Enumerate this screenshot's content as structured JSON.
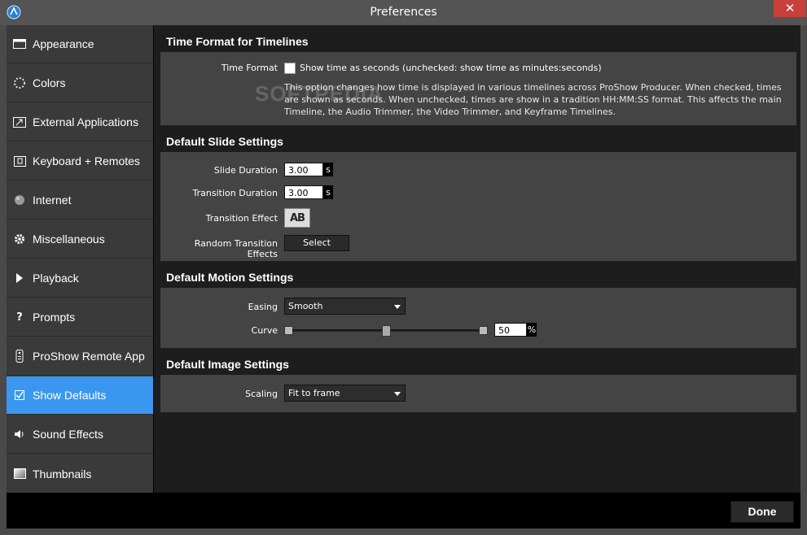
{
  "window": {
    "title": "Preferences",
    "close_glyph": "✕"
  },
  "sidebar": {
    "items": [
      {
        "label": "Appearance",
        "icon": "appearance-icon"
      },
      {
        "label": "Colors",
        "icon": "colors-icon"
      },
      {
        "label": "External Applications",
        "icon": "external-apps-icon"
      },
      {
        "label": "Keyboard + Remotes",
        "icon": "keyboard-icon"
      },
      {
        "label": "Internet",
        "icon": "internet-icon"
      },
      {
        "label": "Miscellaneous",
        "icon": "gear-icon"
      },
      {
        "label": "Playback",
        "icon": "play-icon"
      },
      {
        "label": "Prompts",
        "icon": "question-icon"
      },
      {
        "label": "ProShow Remote App",
        "icon": "remote-icon"
      },
      {
        "label": "Show Defaults",
        "icon": "checkbox-icon",
        "active": true
      },
      {
        "label": "Sound Effects",
        "icon": "speaker-icon"
      },
      {
        "label": "Thumbnails",
        "icon": "thumbnail-icon"
      }
    ]
  },
  "time_format": {
    "section_title": "Time Format for Timelines",
    "label": "Time Format",
    "checkbox_label": "Show time as seconds (unchecked: show time as minutes:seconds)",
    "checked": false,
    "description": "This option changes how time is displayed in various timelines across ProShow Producer. When checked, times are shown as seconds. When unchecked, times are show in a tradition HH:MM:SS format. This affects the main Timeline, the Audio Trimmer, the Video Trimmer, and Keyframe Timelines."
  },
  "slide": {
    "section_title": "Default Slide Settings",
    "slide_duration_label": "Slide Duration",
    "slide_duration_value": "3.00",
    "slide_duration_unit": "s",
    "transition_duration_label": "Transition Duration",
    "transition_duration_value": "3.00",
    "transition_duration_unit": "s",
    "transition_effect_label": "Transition Effect",
    "transition_effect_glyph": "AB",
    "random_label": "Random Transition Effects",
    "select_button": "Select"
  },
  "motion": {
    "section_title": "Default Motion Settings",
    "easing_label": "Easing",
    "easing_value": "Smooth",
    "curve_label": "Curve",
    "curve_value": "50",
    "curve_unit": "%"
  },
  "image": {
    "section_title": "Default Image Settings",
    "scaling_label": "Scaling",
    "scaling_value": "Fit to frame"
  },
  "watermark": "SOFTPEDIA",
  "footer": {
    "done_label": "Done"
  }
}
